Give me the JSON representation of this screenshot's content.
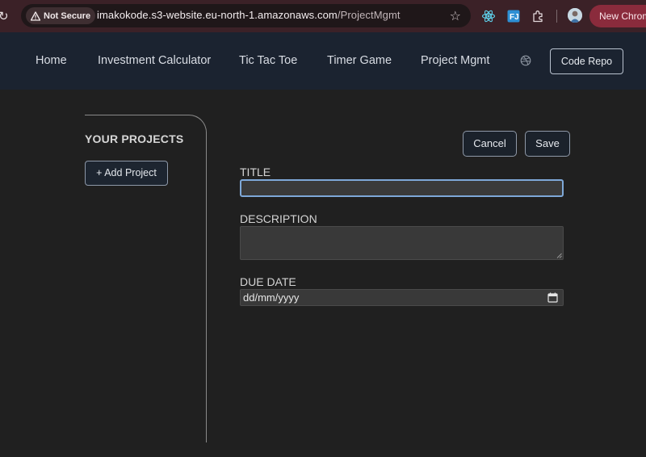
{
  "browser": {
    "security_chip": "Not Secure",
    "url_host": "imakokode.s3-website.eu-north-1.amazonaws.com",
    "url_path": "/ProjectMgmt",
    "new_chrome_label": "New Chrom",
    "icons": [
      "reload-icon",
      "warning-icon",
      "star-icon",
      "react-devtools-icon",
      "extension-fj-icon",
      "puzzle-icon",
      "profile-avatar"
    ]
  },
  "nav": {
    "items": [
      {
        "label": "Home"
      },
      {
        "label": "Investment Calculator"
      },
      {
        "label": "Tic Tac Toe"
      },
      {
        "label": "Timer Game"
      },
      {
        "label": "Project Mgmt"
      }
    ],
    "icon": "dribbble-icon",
    "code_repo_label": "Code Repo"
  },
  "sidebar": {
    "title": "YOUR PROJECTS",
    "add_button_label": "+ Add Project"
  },
  "form": {
    "cancel_label": "Cancel",
    "save_label": "Save",
    "title_label": "TITLE",
    "title_value": "",
    "description_label": "DESCRIPTION",
    "description_value": "",
    "due_date_label": "DUE DATE",
    "due_date_placeholder": "dd/mm/yyyy"
  },
  "colors": {
    "chrome_bg": "#3b2127",
    "nav_bg": "#1b2330",
    "page_bg": "#202020",
    "focus_ring": "#7ea8d8",
    "new_chrome_bg": "#8a2b3c"
  }
}
